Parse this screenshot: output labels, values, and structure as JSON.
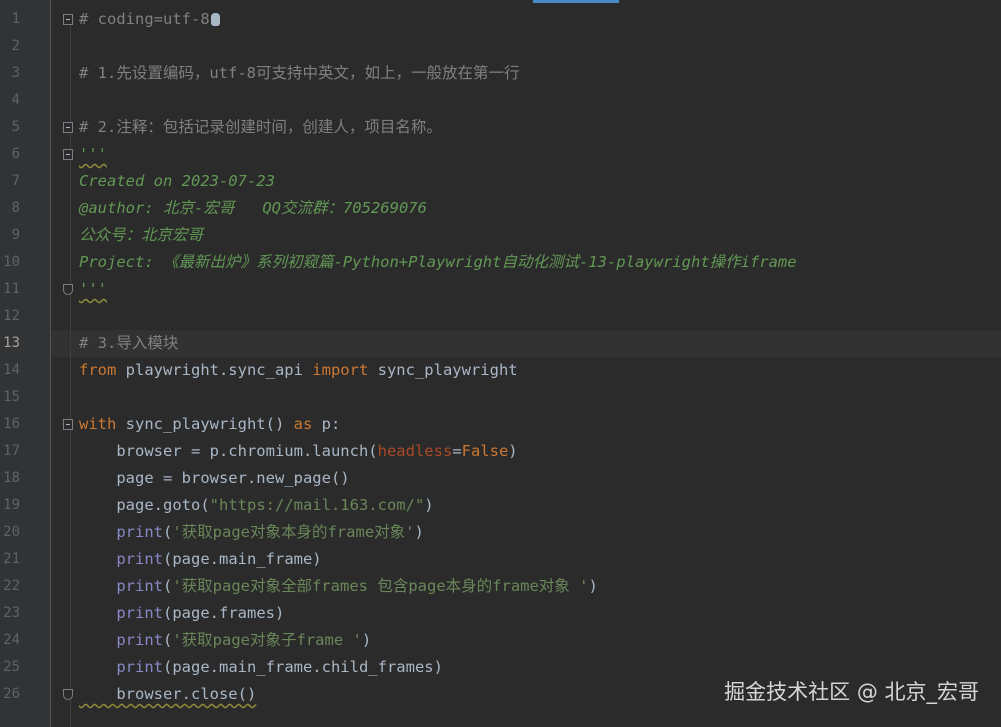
{
  "editor": {
    "current_line": "13",
    "lines": [
      {
        "n": "1",
        "segs": [
          {
            "t": "# coding=utf-8",
            "c": "c-comment"
          }
        ]
      },
      {
        "n": "2",
        "segs": []
      },
      {
        "n": "3",
        "segs": [
          {
            "t": "# 1.先设置编码，utf-8可支持中英文，如上，一般放在第一行",
            "c": "c-comment"
          }
        ]
      },
      {
        "n": "4",
        "segs": []
      },
      {
        "n": "5",
        "segs": [
          {
            "t": "# 2.注释：包括记录创建时间，创建人，项目名称。",
            "c": "c-comment"
          }
        ]
      },
      {
        "n": "6",
        "segs": [
          {
            "t": "'''",
            "c": "c-doc"
          }
        ]
      },
      {
        "n": "7",
        "segs": [
          {
            "t": "Created on 2023-07-23",
            "c": "c-doc"
          }
        ]
      },
      {
        "n": "8",
        "segs": [
          {
            "t": "@author: 北京-宏哥   QQ交流群：705269076",
            "c": "c-doc"
          }
        ]
      },
      {
        "n": "9",
        "segs": [
          {
            "t": "公众号：北京宏哥",
            "c": "c-doc"
          }
        ]
      },
      {
        "n": "10",
        "segs": [
          {
            "t": "Project: 《最新出炉》系列初窥篇-Python+Playwright自动化测试-13-playwright操作iframe",
            "c": "c-doc"
          }
        ]
      },
      {
        "n": "11",
        "segs": [
          {
            "t": "'''",
            "c": "c-doc"
          }
        ]
      },
      {
        "n": "12",
        "segs": []
      },
      {
        "n": "13",
        "segs": [
          {
            "t": "# 3.导入模块",
            "c": "c-comment"
          }
        ]
      },
      {
        "n": "14",
        "segs": [
          {
            "t": "from",
            "c": "c-kw"
          },
          {
            "t": " playwright.sync_api ",
            "c": "c-plain"
          },
          {
            "t": "import",
            "c": "c-kw"
          },
          {
            "t": " sync_playwright",
            "c": "c-plain"
          }
        ]
      },
      {
        "n": "15",
        "segs": []
      },
      {
        "n": "16",
        "segs": [
          {
            "t": "with",
            "c": "c-kw"
          },
          {
            "t": " sync_playwright() ",
            "c": "c-plain"
          },
          {
            "t": "as",
            "c": "c-kw"
          },
          {
            "t": " p:",
            "c": "c-plain"
          }
        ]
      },
      {
        "n": "17",
        "segs": [
          {
            "t": "    browser = p.chromium.launch(",
            "c": "c-plain"
          },
          {
            "t": "headless",
            "c": "c-param"
          },
          {
            "t": "=",
            "c": "c-plain"
          },
          {
            "t": "False",
            "c": "c-kw"
          },
          {
            "t": ")",
            "c": "c-plain"
          }
        ]
      },
      {
        "n": "18",
        "segs": [
          {
            "t": "    page = browser.new_page()",
            "c": "c-plain"
          }
        ]
      },
      {
        "n": "19",
        "segs": [
          {
            "t": "    page.goto(",
            "c": "c-plain"
          },
          {
            "t": "\"https://mail.163.com/\"",
            "c": "c-str"
          },
          {
            "t": ")",
            "c": "c-plain"
          }
        ]
      },
      {
        "n": "20",
        "segs": [
          {
            "t": "    ",
            "c": "c-plain"
          },
          {
            "t": "print",
            "c": "c-builtin"
          },
          {
            "t": "(",
            "c": "c-plain"
          },
          {
            "t": "'获取page对象本身的frame对象'",
            "c": "c-str"
          },
          {
            "t": ")",
            "c": "c-plain"
          }
        ]
      },
      {
        "n": "21",
        "segs": [
          {
            "t": "    ",
            "c": "c-plain"
          },
          {
            "t": "print",
            "c": "c-builtin"
          },
          {
            "t": "(page.main_frame)",
            "c": "c-plain"
          }
        ]
      },
      {
        "n": "22",
        "segs": [
          {
            "t": "    ",
            "c": "c-plain"
          },
          {
            "t": "print",
            "c": "c-builtin"
          },
          {
            "t": "(",
            "c": "c-plain"
          },
          {
            "t": "'获取page对象全部frames 包含page本身的frame对象 '",
            "c": "c-str"
          },
          {
            "t": ")",
            "c": "c-plain"
          }
        ]
      },
      {
        "n": "23",
        "segs": [
          {
            "t": "    ",
            "c": "c-plain"
          },
          {
            "t": "print",
            "c": "c-builtin"
          },
          {
            "t": "(page.frames)",
            "c": "c-plain"
          }
        ]
      },
      {
        "n": "24",
        "segs": [
          {
            "t": "    ",
            "c": "c-plain"
          },
          {
            "t": "print",
            "c": "c-builtin"
          },
          {
            "t": "(",
            "c": "c-plain"
          },
          {
            "t": "'获取page对象子frame '",
            "c": "c-str"
          },
          {
            "t": ")",
            "c": "c-plain"
          }
        ]
      },
      {
        "n": "25",
        "segs": [
          {
            "t": "    ",
            "c": "c-plain"
          },
          {
            "t": "print",
            "c": "c-builtin"
          },
          {
            "t": "(page.main_frame.child_frames)",
            "c": "c-plain"
          }
        ]
      },
      {
        "n": "26",
        "segs": [
          {
            "t": "    browser.close()",
            "c": "c-plain"
          }
        ]
      }
    ]
  },
  "watermark": "掘金技术社区 @ 北京_宏哥"
}
